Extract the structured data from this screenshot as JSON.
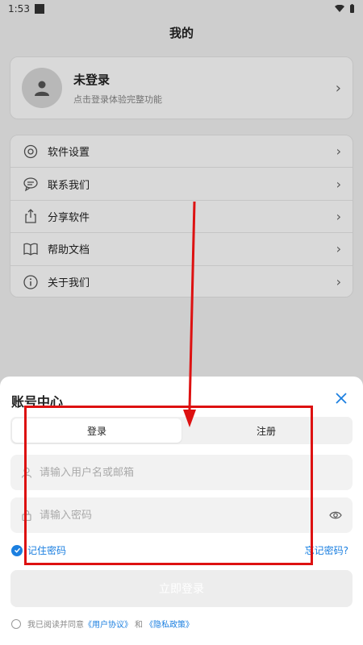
{
  "status_bar": {
    "time": "1:53"
  },
  "page": {
    "title": "我的"
  },
  "profile": {
    "name": "未登录",
    "subtitle": "点击登录体验完整功能"
  },
  "menu": {
    "items": [
      {
        "label": "软件设置",
        "icon": "settings-icon"
      },
      {
        "label": "联系我们",
        "icon": "chat-icon"
      },
      {
        "label": "分享软件",
        "icon": "share-icon"
      },
      {
        "label": "帮助文档",
        "icon": "book-icon"
      },
      {
        "label": "关于我们",
        "icon": "info-icon"
      }
    ]
  },
  "sheet": {
    "title": "账号中心",
    "tabs": [
      {
        "label": "登录",
        "active": true
      },
      {
        "label": "注册",
        "active": false
      }
    ],
    "username_placeholder": "请输入用户名或邮箱",
    "password_placeholder": "请输入密码",
    "remember_label": "记住密码",
    "forgot_label": "忘记密码?",
    "login_button": "立即登录",
    "agree_prefix": "我已阅读并同意",
    "user_agreement": "《用户协议》",
    "and": "和",
    "privacy_policy": "《隐私政策》"
  },
  "colors": {
    "accent": "#1b7fe0",
    "annotation": "#dd1111"
  }
}
